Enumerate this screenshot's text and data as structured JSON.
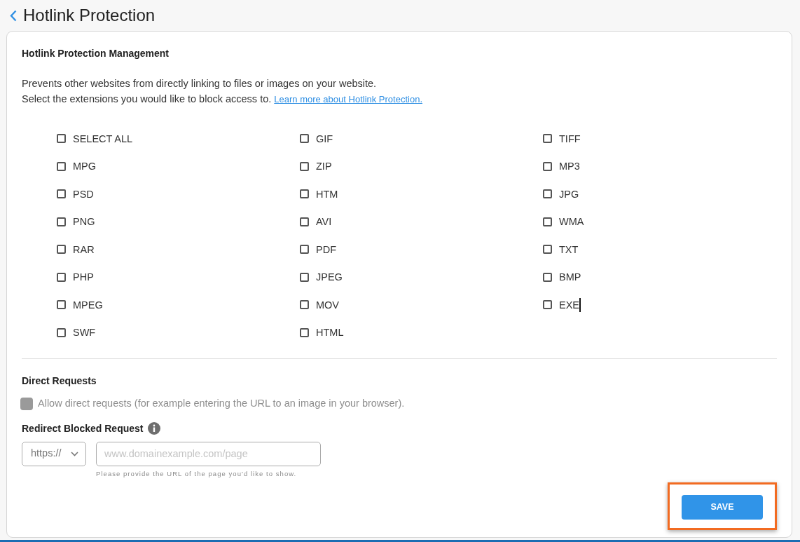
{
  "header": {
    "title": "Hotlink Protection"
  },
  "management": {
    "heading": "Hotlink Protection Management",
    "description": "Prevents other websites from directly linking to files or images on your website.",
    "instruction": "Select the extensions you would like to block access to.",
    "link": "Learn more about Hotlink Protection.",
    "options": [
      {
        "label": "SELECT ALL",
        "checked": false,
        "hovered": false
      },
      {
        "label": "GIF",
        "checked": false,
        "hovered": false
      },
      {
        "label": "TIFF",
        "checked": false,
        "hovered": false
      },
      {
        "label": "MPG",
        "checked": false,
        "hovered": false
      },
      {
        "label": "ZIP",
        "checked": false,
        "hovered": false
      },
      {
        "label": "MP3",
        "checked": false,
        "hovered": false
      },
      {
        "label": "PSD",
        "checked": false,
        "hovered": false
      },
      {
        "label": "HTM",
        "checked": false,
        "hovered": false
      },
      {
        "label": "JPG",
        "checked": false,
        "hovered": false
      },
      {
        "label": "PNG",
        "checked": false,
        "hovered": false
      },
      {
        "label": "AVI",
        "checked": false,
        "hovered": false
      },
      {
        "label": "WMA",
        "checked": false,
        "hovered": false
      },
      {
        "label": "RAR",
        "checked": false,
        "hovered": false
      },
      {
        "label": "PDF",
        "checked": false,
        "hovered": false
      },
      {
        "label": "TXT",
        "checked": false,
        "hovered": false
      },
      {
        "label": "PHP",
        "checked": false,
        "hovered": false
      },
      {
        "label": "JPEG",
        "checked": false,
        "hovered": false
      },
      {
        "label": "BMP",
        "checked": false,
        "hovered": false
      },
      {
        "label": "MPEG",
        "checked": false,
        "hovered": false
      },
      {
        "label": "MOV",
        "checked": false,
        "hovered": false
      },
      {
        "label": "EXE",
        "checked": false,
        "hovered": true
      },
      {
        "label": "SWF",
        "checked": false,
        "hovered": false
      },
      {
        "label": "HTML",
        "checked": false,
        "hovered": false
      }
    ]
  },
  "direct_requests": {
    "heading": "Direct Requests",
    "allow": {
      "label": "Allow direct requests (for example entering the URL to an image in your browser).",
      "checked": false,
      "disabled": true
    }
  },
  "redirect": {
    "heading": "Redirect Blocked Request",
    "protocol": "https://",
    "url_placeholder": "www.domainexample.com/page",
    "help": "Please provide the URL of the page you'd like to show."
  },
  "save_button": {
    "label": "SAVE",
    "highlighted": true
  }
}
